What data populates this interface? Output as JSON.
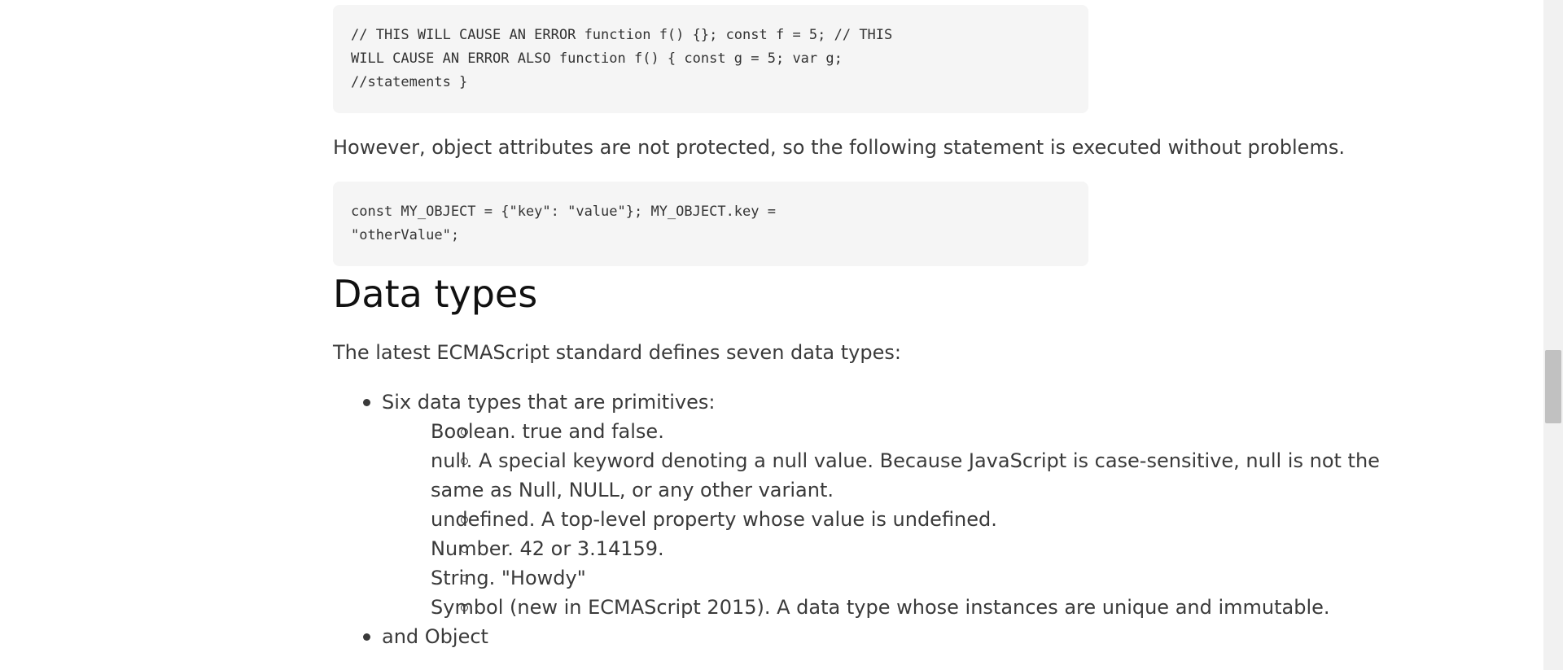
{
  "code_blocks": {
    "first": "// THIS WILL CAUSE AN ERROR function f() {}; const f = 5; // THIS\nWILL CAUSE AN ERROR ALSO function f() { const g = 5; var g;\n//statements }",
    "second": "const MY_OBJECT = {\"key\": \"value\"}; MY_OBJECT.key =\n\"otherValue\";"
  },
  "paragraphs": {
    "object_attributes": "However, object attributes are not protected, so the following statement is executed without problems.",
    "standard_intro": "The latest ECMAScript standard defines seven data types:"
  },
  "heading": "Data types",
  "data_types": {
    "primitives_label": "Six data types that are primitives:",
    "primitives": [
      "Boolean. true and false.",
      "null. A special keyword denoting a null value. Because JavaScript is case-sensitive, null is not the same as Null, NULL, or any other variant.",
      "undefined. A top-level property whose value is undefined.",
      "Number. 42 or 3.14159.",
      "String. \"Howdy\"",
      "Symbol (new in ECMAScript 2015). A data type whose instances are unique and immutable."
    ],
    "object_label": "and Object"
  },
  "scroll_position_fraction": 0.52
}
